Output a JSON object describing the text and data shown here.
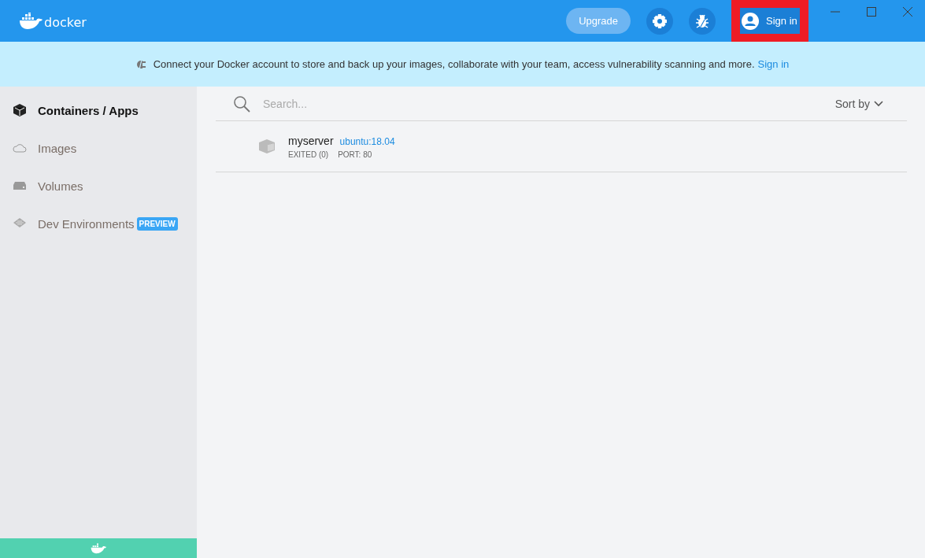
{
  "header": {
    "logo": "docker",
    "upgrade": "Upgrade",
    "sign_in": {
      "label": "Sign in",
      "highlighted": true
    }
  },
  "banner": {
    "text": "Connect your Docker account to store and back up your images, collaborate with your team, access vulnerability scanning and more.",
    "link": "Sign in"
  },
  "sidebar": {
    "items": [
      {
        "label": "Containers / Apps",
        "kind": "containers",
        "selected": true
      },
      {
        "label": "Images",
        "kind": "images",
        "selected": false
      },
      {
        "label": "Volumes",
        "kind": "volumes",
        "selected": false
      },
      {
        "label": "Dev Environments",
        "kind": "dev",
        "selected": false,
        "badge": "PREVIEW"
      }
    ]
  },
  "search": {
    "placeholder": "Search...",
    "sort": "Sort by"
  },
  "containers": [
    {
      "name": "myserver",
      "image": "ubuntu:18.04",
      "status": "EXITED (0)",
      "port": "PORT: 80"
    }
  ]
}
